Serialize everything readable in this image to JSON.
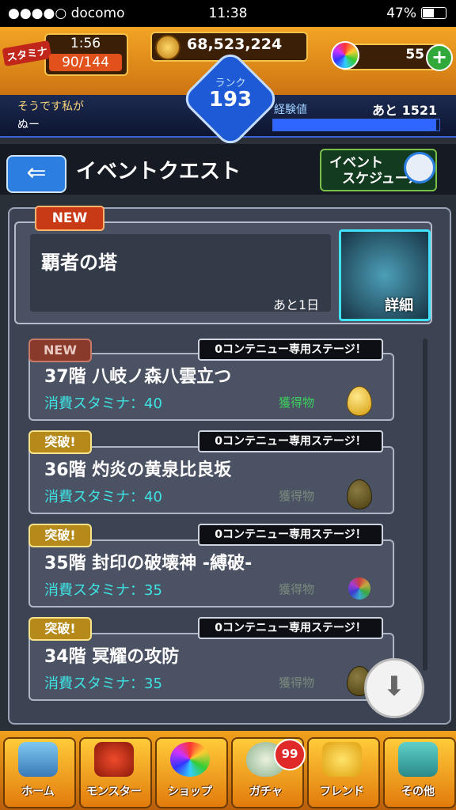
{
  "status_bar": {
    "carrier": "●●●●○ docomo",
    "time": "11:38",
    "battery": "47%"
  },
  "header": {
    "stamina_label": "スタミナ",
    "stamina_timer": "1:56",
    "stamina_value": "90/144",
    "coins": "68,523,224",
    "orbs": "55",
    "plus_label": "+",
    "rank_label": "ランク",
    "rank_value": "193",
    "user_line1": "そうです私が",
    "user_line2": "ぬー",
    "exp_label": "経験値",
    "exp_remaining": "あと 1521",
    "exp_fraction": 0.98
  },
  "title_bar": {
    "back_symbol": "⇐",
    "title": "イベントクエスト",
    "schedule_label_1": "イベント",
    "schedule_label_2": "スケジュール"
  },
  "featured": {
    "badge": "NEW",
    "name": "覇者の塔",
    "remaining": "あと1日",
    "detail_label": "詳細"
  },
  "stages": [
    {
      "badge": "NEW",
      "tag": "0コンテニュー専用ステージ！",
      "name": "37階 八岐ノ森八雲立つ",
      "stamina": "消費スタミナ：40",
      "reward_label": "獲得物",
      "reward": "gold-egg"
    },
    {
      "badge": "突破!",
      "tag": "0コンテニュー専用ステージ！",
      "name": "36階 灼炎の黄泉比良坂",
      "stamina": "消費スタミナ：40",
      "reward_label": "獲得物",
      "reward": "dim-egg"
    },
    {
      "badge": "突破!",
      "tag": "0コンテニュー専用ステージ！",
      "name": "35階 封印の破壊神 -縛破-",
      "stamina": "消費スタミナ：35",
      "reward_label": "獲得物",
      "reward": "orb"
    },
    {
      "badge": "突破!",
      "tag": "0コンテニュー専用ステージ！",
      "name": "34階 冥耀の攻防",
      "stamina": "消費スタミナ：35",
      "reward_label": "獲得物",
      "reward": "dim-egg"
    }
  ],
  "download_symbol": "⬇",
  "bottom_nav": [
    {
      "label": "ホーム",
      "icon": "home-icon"
    },
    {
      "label": "モンスター",
      "icon": "monster-icon"
    },
    {
      "label": "ショップ",
      "icon": "shop-orb-icon"
    },
    {
      "label": "ガチャ",
      "icon": "gacha-egg-icon",
      "badge": "99"
    },
    {
      "label": "フレンド",
      "icon": "friend-icon"
    },
    {
      "label": "その他",
      "icon": "other-icon"
    }
  ],
  "colors": {
    "header_orange": "#f3a524",
    "stamina_cyan": "#3ee4e4",
    "reward_green": "#3cd060",
    "rank_blue": "#1f5ad6"
  }
}
